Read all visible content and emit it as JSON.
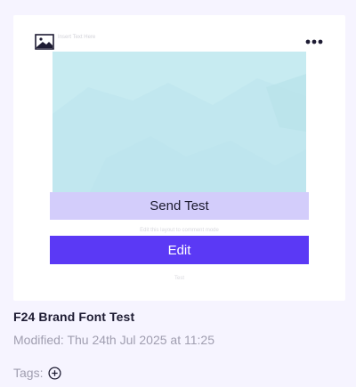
{
  "card": {
    "preview": {
      "insert_text": "Insert Text Here",
      "send_test_label": "Send Test",
      "hint_text": "Edit this layout to comment mode",
      "edit_label": "Edit",
      "footer_text": "Test",
      "image_icon": "image-icon",
      "menu_icon": "more-dots-icon"
    },
    "title": "F24 Brand Font Test",
    "modified": "Modified: Thu 24th Jul 2025 at 11:25",
    "tags_label": "Tags:",
    "add_tag_icon": "plus-circle-icon"
  },
  "colors": {
    "page_bg": "#f6f4ff",
    "accent": "#5b39f5",
    "accent_light": "#d3cdfb",
    "hero": "#c7ebf1"
  }
}
